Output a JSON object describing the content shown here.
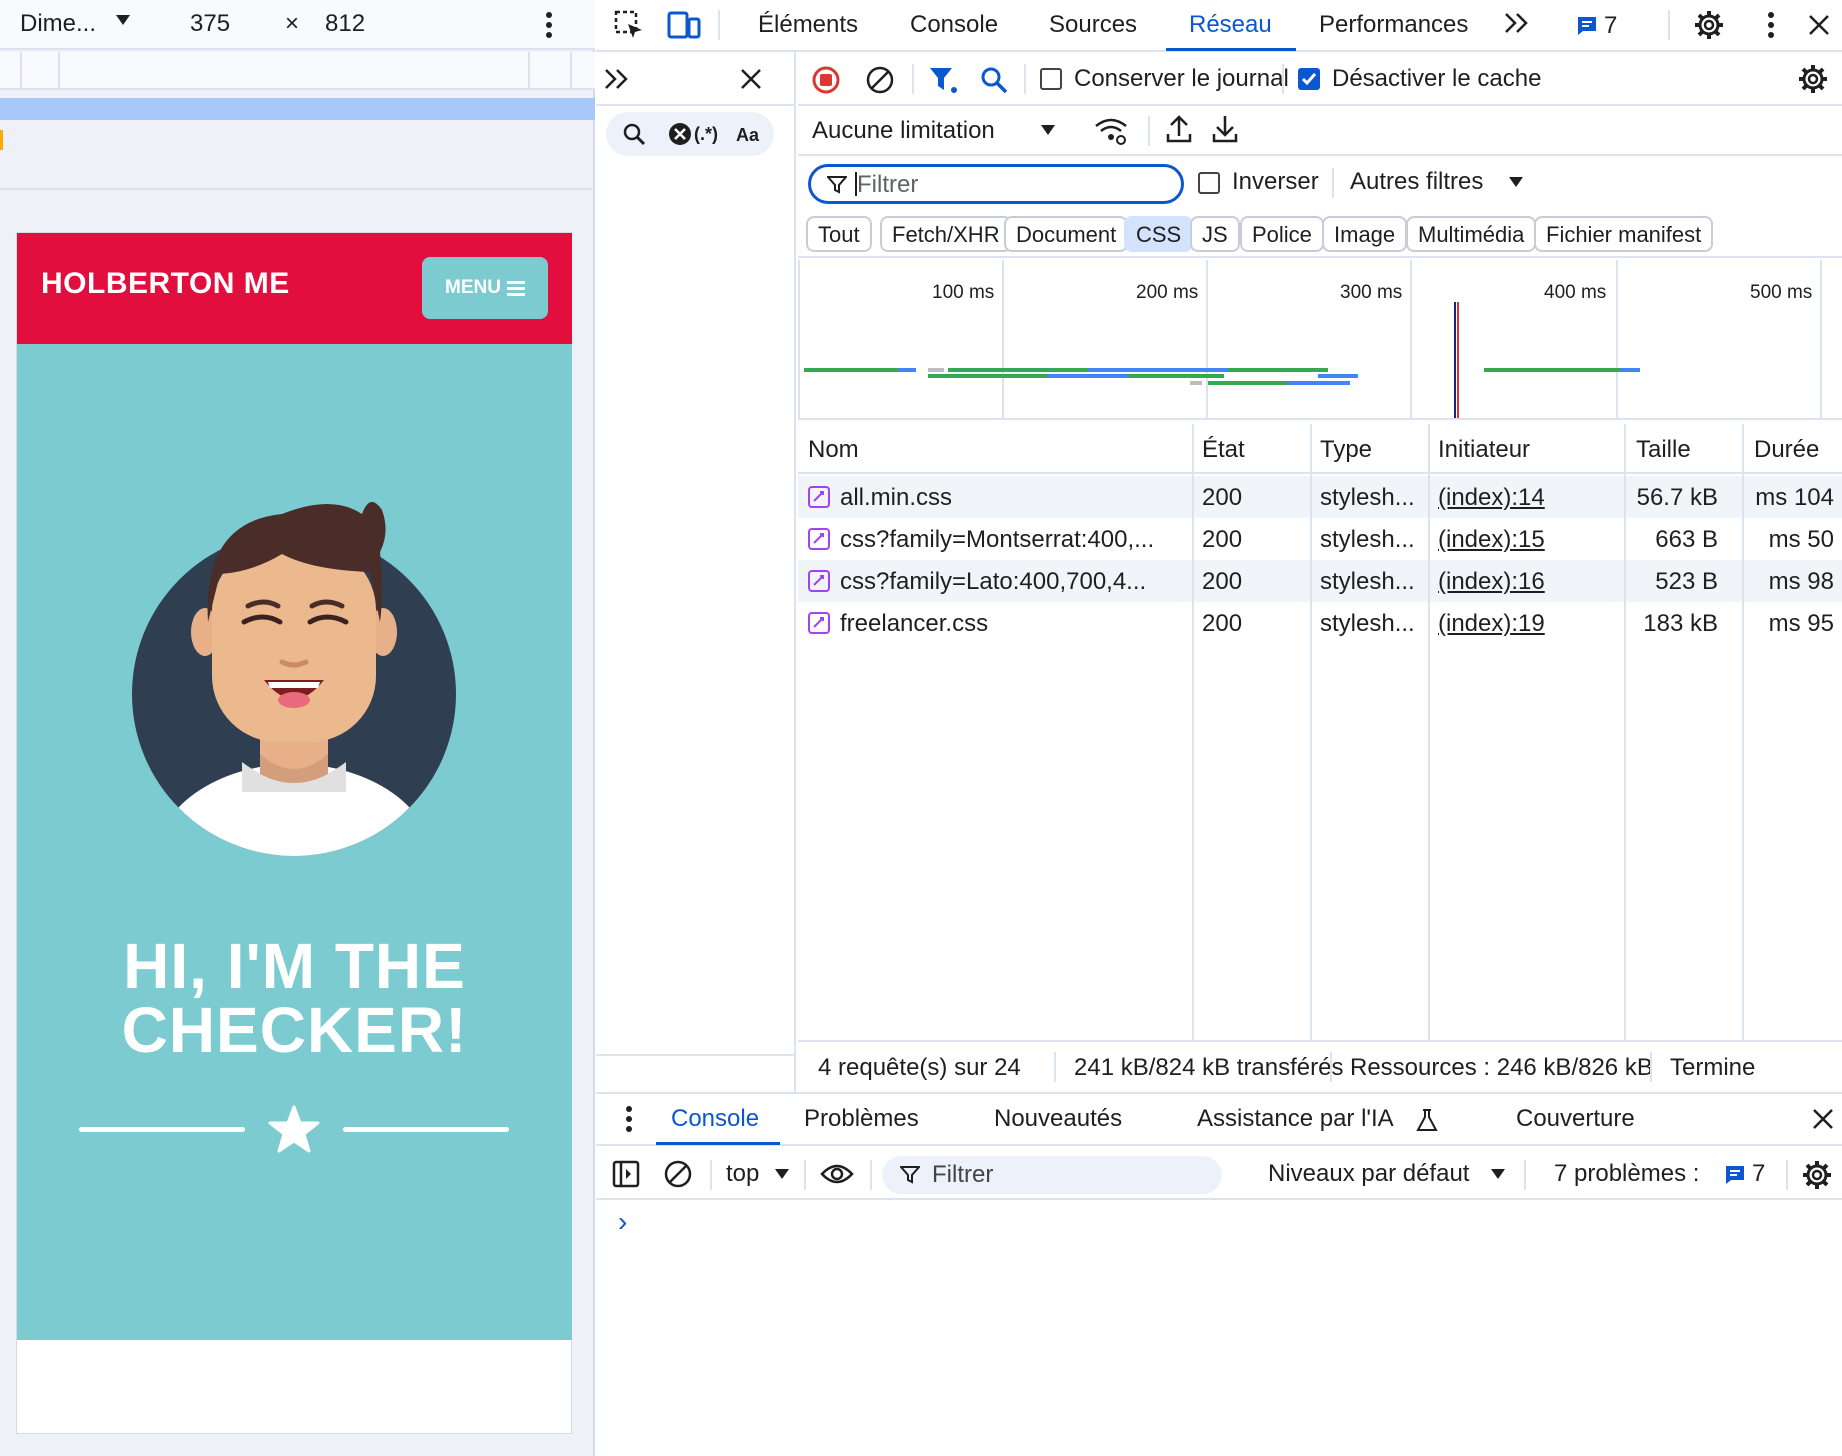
{
  "device_toolbar": {
    "device": "Dime...",
    "width": "375",
    "times": "×",
    "height": "812"
  },
  "site": {
    "brand": "HOLBERTON ME",
    "menu_label": "MENU",
    "hero_line1": "HI, I'M THE",
    "hero_line2": "CHECKER!",
    "colors": {
      "nav": "#e20e3d",
      "masthead": "#7ccbd1",
      "avatar_bg": "#2f3e50"
    }
  },
  "devtools": {
    "tabs": [
      "Éléments",
      "Console",
      "Sources",
      "Réseau",
      "Performances"
    ],
    "active_tab": "Réseau",
    "issues_count": "7",
    "network": {
      "preserve_log": "Conserver le journal",
      "disable_cache": "Désactiver le cache",
      "throttling": "Aucune limitation",
      "filter_placeholder": "Filtrer",
      "invert": "Inverser",
      "more_filters": "Autres filtres",
      "type_filters": [
        "Tout",
        "Fetch/XHR",
        "Document",
        "CSS",
        "JS",
        "Police",
        "Image",
        "Multimédia",
        "Fichier manifest"
      ],
      "selected_filter": "CSS",
      "timeline_labels": [
        "100 ms",
        "200 ms",
        "300 ms",
        "400 ms",
        "500 ms"
      ],
      "columns": [
        "Nom",
        "État",
        "Type",
        "Initiateur",
        "Taille",
        "Durée"
      ],
      "rows": [
        {
          "name": "all.min.css",
          "status": "200",
          "type": "stylesh...",
          "initiator": "(index):14",
          "size": "56.7 kB",
          "time": "104 ms"
        },
        {
          "name": "css?family=Montserrat:400,...",
          "status": "200",
          "type": "stylesh...",
          "initiator": "(index):15",
          "size": "663 B",
          "time": "50 ms"
        },
        {
          "name": "css?family=Lato:400,700,4...",
          "status": "200",
          "type": "stylesh...",
          "initiator": "(index):16",
          "size": "523 B",
          "time": "98 ms"
        },
        {
          "name": "freelancer.css",
          "status": "200",
          "type": "stylesh...",
          "initiator": "(index):19",
          "size": "183 kB",
          "time": "95 ms"
        }
      ],
      "summary": {
        "requests": "4 requête(s) sur 24",
        "transferred": "241 kB/824 kB transférés",
        "resources": "Ressources : 246 kB/826 kB",
        "finish": "Termine"
      }
    },
    "side_search": {
      "regex": "(.*)",
      "case": "Aa"
    },
    "drawer": {
      "tabs": [
        "Console",
        "Problèmes",
        "Nouveautés",
        "Assistance par l'IA",
        "Couverture"
      ],
      "active_tab": "Console",
      "context": "top",
      "filter_placeholder": "Filtrer",
      "levels": "Niveaux par défaut",
      "issues_label": "7 problèmes :",
      "issues_count": "7",
      "prompt": "›"
    }
  }
}
